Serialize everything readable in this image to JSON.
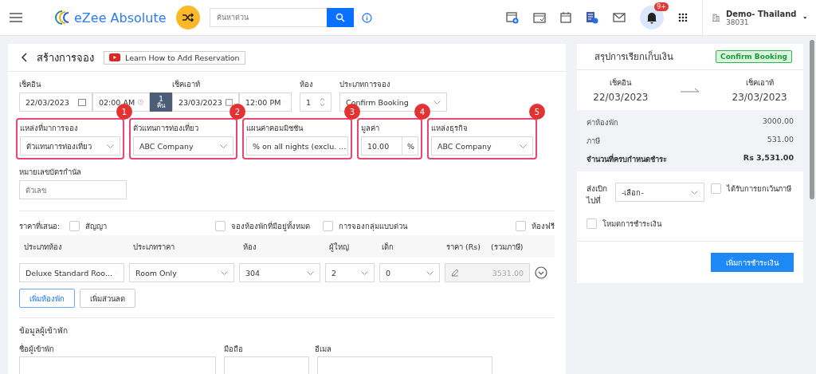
{
  "topbar": {
    "logo": "eZee Absolute",
    "search": {
      "placeholder": "ค้นหาด่วน"
    },
    "notifications": "9+",
    "property": {
      "name": "Demo- Thailand",
      "code": "38031"
    }
  },
  "page": {
    "title": "สร้างการจอง",
    "help_button": "Learn How to Add Reservation"
  },
  "stay": {
    "checkin_label": "เช็คอิน",
    "checkin_date": "22/03/2023",
    "checkin_time": "02:00 AM",
    "nights": "1",
    "nights_unit": "คืน",
    "checkout_label": "เช็คเอาท์",
    "checkout_date": "23/03/2023",
    "checkout_time": "12:00 PM",
    "rooms_label": "ห้อง",
    "rooms": "1",
    "booking_type_label": "ประเภทการจอง",
    "booking_type": "Confirm Booking"
  },
  "highlighted_fields": [
    {
      "marker": "1",
      "label": "แหล่งที่มาการจอง",
      "value": "ตัวแทนการท่องเที่ยว",
      "kind": "select"
    },
    {
      "marker": "2",
      "label": "ตัวแทนการท่องเที่ยว",
      "value": "ABC Company",
      "kind": "select"
    },
    {
      "marker": "3",
      "label": "แผนค่าคอมมิชชัน",
      "value": "% on all nights (exclu. ...",
      "kind": "select"
    },
    {
      "marker": "4",
      "label": "มูลค่า",
      "value": "10.00",
      "suffix": "%",
      "kind": "number"
    },
    {
      "marker": "5",
      "label": "แหล่งธุรกิจ",
      "value": "ABC Company",
      "kind": "select"
    }
  ],
  "voucher": {
    "label": "หมายเลขบัตรกำนัล",
    "placeholder": "ตัวเลข"
  },
  "rate_options": {
    "label": "ราคาที่เสนอ:",
    "options": [
      {
        "label": "สัญญา",
        "checked": false
      },
      {
        "label": "จองห้องพักที่มีอยู่ทั้งหมด",
        "checked": false
      },
      {
        "label": "การจองกลุ่มแบบด่วน",
        "checked": false
      },
      {
        "label": "ห้องฟรี",
        "checked": false
      }
    ]
  },
  "rooms_table": {
    "columns": [
      "ประเภทห้อง",
      "ประเภทราคา",
      "ห้อง",
      "ผู้ใหญ่",
      "เด็ก",
      "ราคา (Rs)",
      "(รวมภาษี)"
    ],
    "rows": [
      {
        "room_type": "Deluxe Standard Roo...",
        "rate_type": "Room Only",
        "room": "304",
        "adults": "2",
        "children": "0",
        "price": "3531.00"
      }
    ]
  },
  "room_buttons": [
    "เพิ่มห้องพัก",
    "เพิ่มส่วนลด"
  ],
  "guest": {
    "title": "ข้อมูลผู้เข้าพัก",
    "labels": [
      "ชื่อผู้เข้าพัก",
      "มือถือ",
      "อีเมล"
    ]
  },
  "summary": {
    "title": "สรุปการเรียกเก็บเงิน",
    "status": "Confirm Booking",
    "checkin_label": "เช็คอิน",
    "checkin_date": "22/03/2023",
    "checkout_label": "เช็คเอาท์",
    "checkout_date": "23/03/2023",
    "lines": [
      {
        "label": "ค่าห้องพัก",
        "amount": "3000.00",
        "kind": "line"
      },
      {
        "label": "ภาษี",
        "amount": "531.00",
        "kind": "line"
      },
      {
        "label": "จำนวนที่ครบกำหนดชำระ",
        "amount": "Rs 3,531.00",
        "kind": "total"
      }
    ],
    "bill_to_label": "ส่งเบิกไปที่",
    "bill_to": "-เลือก-",
    "tax_exempt": {
      "label": "ได้รับการยกเว้นภาษี",
      "checked": false
    },
    "payment_mode": {
      "label": "โหมดการชำระเงิน",
      "checked": false
    },
    "add_payment": "เพิ่มการชำระเงิน"
  }
}
